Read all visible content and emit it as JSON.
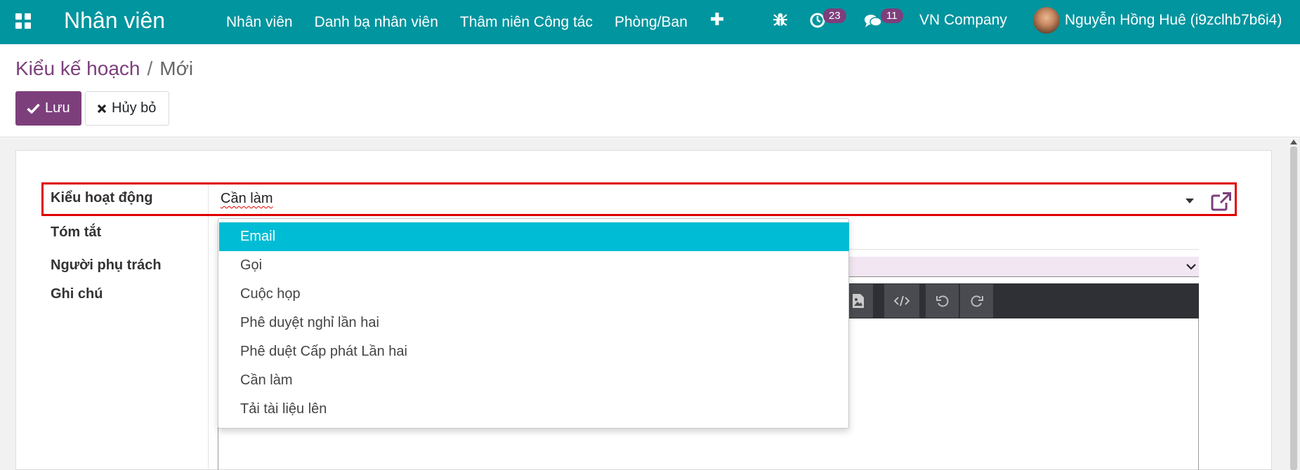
{
  "navbar": {
    "app_title": "Nhân viên",
    "menu": [
      {
        "label": "Nhân viên"
      },
      {
        "label": "Danh bạ nhân viên"
      },
      {
        "label": "Thâm niên Công tác"
      },
      {
        "label": "Phòng/Ban"
      }
    ],
    "activity_count": "23",
    "message_count": "11",
    "company": "VN Company",
    "user_name": "Nguyễn Hồng Huê (i9zclhb7b6i4)",
    "icons": [
      "apps-icon",
      "plus-icon",
      "bug-icon",
      "clock-icon",
      "chat-icon",
      "avatar"
    ]
  },
  "breadcrumb": {
    "parent": "Kiểu kế hoạch",
    "separator": "/",
    "current": "Mới"
  },
  "buttons": {
    "save": "Lưu",
    "discard": "Hủy bỏ"
  },
  "form": {
    "activity_type_label": "Kiểu hoạt động",
    "activity_type_value": "Cần làm",
    "summary_label": "Tóm tắt",
    "responsible_label": "Người phụ trách",
    "note_label": "Ghi chú"
  },
  "dropdown": {
    "options": [
      {
        "label": "Email",
        "active": true
      },
      {
        "label": "Gọi"
      },
      {
        "label": "Cuộc họp"
      },
      {
        "label": "Phê duyệt nghỉ lần hai"
      },
      {
        "label": "Phê duệt Cấp phát Lần hai"
      },
      {
        "label": "Cần làm"
      },
      {
        "label": "Tải tài liệu lên"
      }
    ]
  },
  "colors": {
    "navbar": "#00959f",
    "primary": "#7c3f7c",
    "dropdown_active": "#00bcd4",
    "highlight_border": "#e00000"
  }
}
